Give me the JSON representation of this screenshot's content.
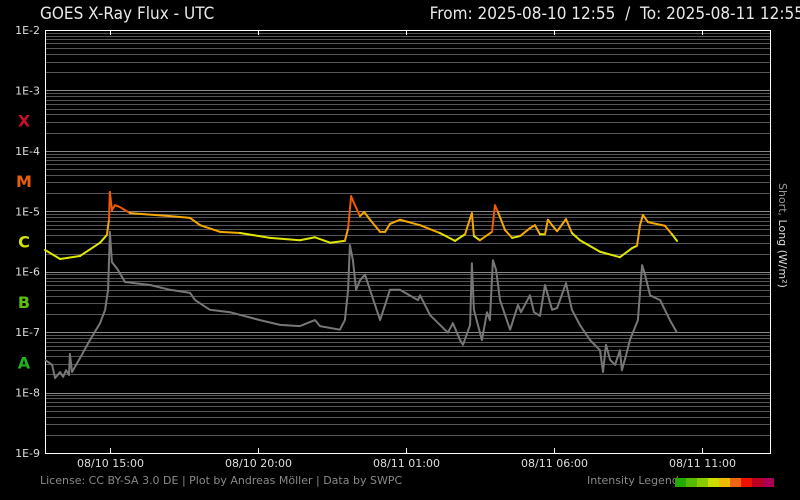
{
  "header": {
    "title": "GOES X-Ray Flux - UTC",
    "range": "From: 2025-08-10 12:55  /  To: 2025-08-11 12:55"
  },
  "footer": {
    "license": "License: CC BY-SA 3.0 DE | Plot by Andreas Möller | Data by SWPC",
    "legend_label": "Intensity Legend",
    "legend_colors": [
      "#22aa00",
      "#55bb00",
      "#88cc00",
      "#ccdd00",
      "#eebb00",
      "#ee6611",
      "#ee1100",
      "#bb0022",
      "#aa0055"
    ]
  },
  "chart_data": {
    "type": "line",
    "title": "GOES X-Ray Flux - UTC",
    "ylabel_short": "Short,",
    "ylabel_long": " Long (W/m²)",
    "yscale": "log",
    "ylim_log10": [
      -9,
      -2
    ],
    "y_ticks": [
      "1E-2",
      "1E-3",
      "1E-4",
      "1E-5",
      "1E-6",
      "1E-7",
      "1E-8",
      "1E-9"
    ],
    "classes": [
      {
        "label": "X",
        "color": "#c8102e",
        "log_center": -3.5
      },
      {
        "label": "M",
        "color": "#e8600c",
        "log_center": -4.5
      },
      {
        "label": "C",
        "color": "#d4e000",
        "log_center": -5.5
      },
      {
        "label": "B",
        "color": "#5cc010",
        "log_center": -6.5
      },
      {
        "label": "A",
        "color": "#20b020",
        "log_center": -7.5
      }
    ],
    "x_unit": "hours since 08/10 12:55 UTC",
    "xlim_hours": [
      -0.1,
      24.5
    ],
    "x_ticks": [
      {
        "label": "08/10 15:00",
        "hours": 2.083
      },
      {
        "label": "08/10 20:00",
        "hours": 7.083
      },
      {
        "label": "08/11 01:00",
        "hours": 12.083
      },
      {
        "label": "08/11 06:00",
        "hours": 17.083
      },
      {
        "label": "08/11 11:00",
        "hours": 22.083
      }
    ],
    "series": [
      {
        "name": "Short",
        "hours": [
          -0.1,
          0.41,
          1.08,
          1.76,
          1.99,
          2.06,
          2.09,
          2.16,
          2.26,
          2.43,
          2.77,
          4.12,
          4.8,
          5.14,
          5.81,
          6.49,
          7.5,
          8.51,
          9.02,
          9.53,
          10.03,
          10.14,
          10.24,
          10.37,
          10.54,
          10.68,
          10.88,
          11.22,
          11.39,
          11.55,
          11.89,
          12.57,
          13.24,
          13.75,
          14.09,
          14.32,
          14.39,
          14.59,
          15.0,
          15.1,
          15.2,
          15.44,
          15.68,
          15.95,
          16.28,
          16.45,
          16.62,
          16.79,
          16.89,
          17.03,
          17.2,
          17.5,
          17.7,
          17.97,
          18.65,
          19.32,
          19.73,
          19.9,
          20.0,
          20.1,
          20.27,
          20.84,
          21.08,
          21.25
        ],
        "log10_flux": [
          -5.64,
          -5.79,
          -5.74,
          -5.52,
          -5.39,
          -5.14,
          -4.68,
          -4.98,
          -4.9,
          -4.93,
          -5.03,
          -5.08,
          -5.11,
          -5.23,
          -5.34,
          -5.36,
          -5.44,
          -5.48,
          -5.43,
          -5.52,
          -5.49,
          -5.28,
          -4.75,
          -4.9,
          -5.08,
          -5.01,
          -5.14,
          -5.34,
          -5.34,
          -5.21,
          -5.14,
          -5.23,
          -5.36,
          -5.49,
          -5.38,
          -5.03,
          -5.41,
          -5.48,
          -5.34,
          -4.9,
          -5.01,
          -5.31,
          -5.44,
          -5.41,
          -5.28,
          -5.23,
          -5.38,
          -5.38,
          -5.14,
          -5.23,
          -5.33,
          -5.13,
          -5.36,
          -5.48,
          -5.67,
          -5.76,
          -5.61,
          -5.57,
          -5.23,
          -5.06,
          -5.18,
          -5.24,
          -5.38,
          -5.49
        ]
      },
      {
        "name": "Long",
        "color": "#777777",
        "hours": [
          -0.1,
          0.14,
          0.24,
          0.41,
          0.51,
          0.61,
          0.71,
          0.74,
          0.81,
          1.08,
          1.42,
          1.76,
          1.93,
          2.03,
          2.09,
          2.16,
          2.36,
          2.6,
          3.45,
          4.12,
          4.8,
          4.97,
          5.47,
          6.15,
          7.16,
          7.84,
          8.51,
          9.02,
          9.19,
          9.86,
          10.03,
          10.14,
          10.2,
          10.3,
          10.41,
          10.54,
          10.71,
          10.88,
          11.22,
          11.39,
          11.55,
          11.89,
          12.5,
          12.57,
          12.91,
          13.51,
          13.68,
          13.92,
          14.02,
          14.26,
          14.32,
          14.39,
          14.66,
          14.83,
          14.93,
          15.03,
          15.14,
          15.27,
          15.61,
          15.88,
          15.98,
          16.28,
          16.42,
          16.62,
          16.79,
          17.03,
          17.2,
          17.5,
          17.7,
          17.97,
          18.31,
          18.65,
          18.75,
          18.85,
          18.99,
          19.16,
          19.32,
          19.39,
          19.53,
          19.66,
          19.93,
          20.07,
          20.17,
          20.34,
          20.68,
          21.01,
          21.25
        ],
        "log10_flux": [
          -7.46,
          -7.54,
          -7.76,
          -7.66,
          -7.74,
          -7.63,
          -7.71,
          -7.36,
          -7.66,
          -7.43,
          -7.13,
          -6.85,
          -6.63,
          -6.3,
          -5.34,
          -5.84,
          -5.97,
          -6.17,
          -6.22,
          -6.3,
          -6.35,
          -6.47,
          -6.63,
          -6.67,
          -6.8,
          -6.88,
          -6.9,
          -6.8,
          -6.9,
          -6.96,
          -6.8,
          -6.3,
          -5.56,
          -5.81,
          -6.3,
          -6.14,
          -6.05,
          -6.3,
          -6.8,
          -6.55,
          -6.3,
          -6.3,
          -6.47,
          -6.39,
          -6.72,
          -7.01,
          -6.85,
          -7.13,
          -7.21,
          -6.88,
          -5.86,
          -6.63,
          -7.13,
          -6.67,
          -6.8,
          -5.81,
          -5.97,
          -6.47,
          -6.96,
          -6.55,
          -6.67,
          -6.39,
          -6.67,
          -6.73,
          -6.22,
          -6.63,
          -6.6,
          -6.19,
          -6.63,
          -6.88,
          -7.13,
          -7.3,
          -7.66,
          -7.21,
          -7.46,
          -7.54,
          -7.3,
          -7.63,
          -7.38,
          -7.13,
          -6.8,
          -5.89,
          -6.05,
          -6.39,
          -6.47,
          -6.8,
          -7.01
        ]
      }
    ],
    "short_colors": {
      "low": "#e0e800",
      "mid": "#f5a800",
      "high": "#f05a00"
    }
  }
}
